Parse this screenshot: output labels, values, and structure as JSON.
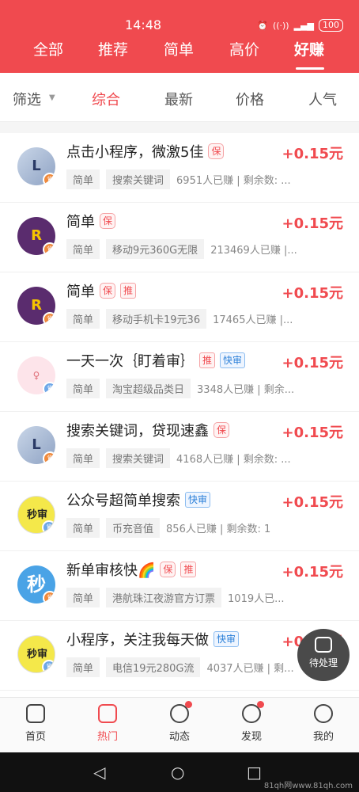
{
  "status": {
    "time": "14:48",
    "battery": "100"
  },
  "top_tabs": [
    "全部",
    "推荐",
    "简单",
    "高价",
    "好赚"
  ],
  "filter": {
    "screen_label": "筛选",
    "sort_options": [
      "综合",
      "最新",
      "价格",
      "人气"
    ]
  },
  "tasks": [
    {
      "title": "点击小程序，微激5佳",
      "badges": [
        "保"
      ],
      "price": "+0.15元",
      "category": "简单",
      "keyword": "搜索关键词",
      "meta": "6951人已赚 | 剩余数: ..."
    },
    {
      "title": "简单",
      "badges": [
        "保"
      ],
      "price": "+0.15元",
      "category": "简单",
      "keyword": "移动9元360G无限",
      "meta": "213469人已赚 |..."
    },
    {
      "title": "简单",
      "badges": [
        "保",
        "推"
      ],
      "price": "+0.15元",
      "category": "简单",
      "keyword": "移动手机卡19元36",
      "meta": "17465人已赚 |..."
    },
    {
      "title": "一天一次｛盯着审｝",
      "badges": [
        "推",
        "快审"
      ],
      "price": "+0.15元",
      "category": "简单",
      "keyword": "淘宝超级品类日",
      "meta": "3348人已赚 | 剩余..."
    },
    {
      "title": "搜索关键词，贷现速鑫",
      "badges": [
        "保"
      ],
      "price": "+0.15元",
      "category": "简单",
      "keyword": "搜索关键词",
      "meta": "4168人已赚 | 剩余数: ..."
    },
    {
      "title": "公众号超简单搜索",
      "badges": [
        "快审"
      ],
      "price": "+0.15元",
      "category": "简单",
      "keyword": "币充音值",
      "meta": "856人已赚 | 剩余数: 1"
    },
    {
      "title": "新单审核快🌈",
      "badges": [
        "保",
        "推"
      ],
      "price": "+0.15元",
      "category": "简单",
      "keyword": "港航珠江夜游官方订票",
      "meta": "1019人已..."
    },
    {
      "title": "小程序，关注我每天做",
      "badges": [
        "快审"
      ],
      "price": "+0.15元",
      "category": "简单",
      "keyword": "电信19元280G流",
      "meta": "4037人已赚 | 剩..."
    }
  ],
  "avatars": [
    "L",
    "R",
    "R",
    "girl",
    "L",
    "秒审",
    "秒",
    "秒审"
  ],
  "float_button": {
    "label": "待处理",
    "icon": "pending-icon"
  },
  "bottom_nav": [
    {
      "label": "首页",
      "icon": "home-icon"
    },
    {
      "label": "热门",
      "icon": "hot-ticket-icon"
    },
    {
      "label": "动态",
      "icon": "broadcast-icon"
    },
    {
      "label": "发现",
      "icon": "compass-icon"
    },
    {
      "label": "我的",
      "icon": "profile-icon"
    }
  ],
  "watermark": "81qh网www.81qh.com",
  "colors": {
    "brand_red": "#f04a4f",
    "quick_blue": "#2a7fd8"
  }
}
